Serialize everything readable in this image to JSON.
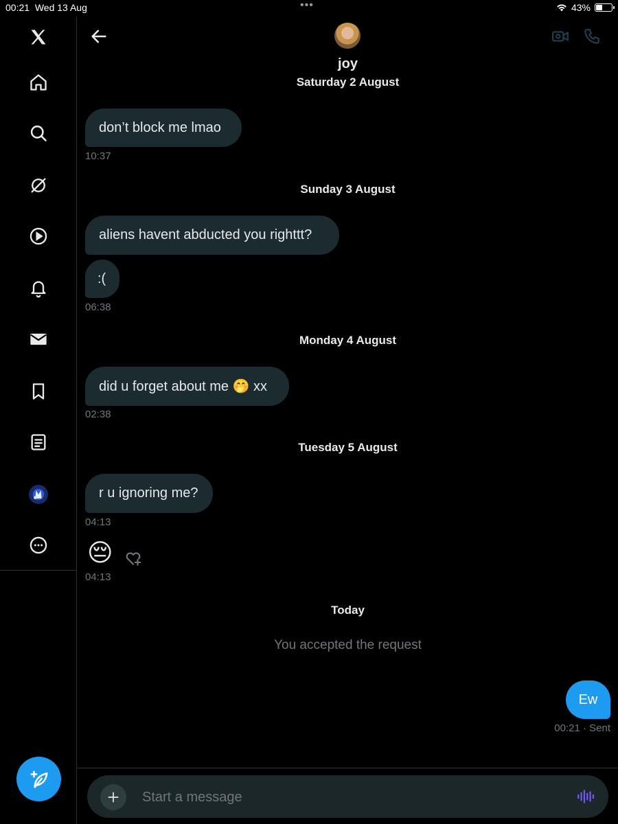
{
  "status_bar": {
    "time": "00:21",
    "date": "Wed 13 Aug",
    "dots": "•••",
    "battery": "43%",
    "battery_level": 0.43
  },
  "sidebar": {
    "items": [
      {
        "name": "x-logo-icon"
      },
      {
        "name": "home-icon"
      },
      {
        "name": "search-icon"
      },
      {
        "name": "grok-icon"
      },
      {
        "name": "video-play-icon"
      },
      {
        "name": "notifications-bell-icon"
      },
      {
        "name": "messages-envelope-icon"
      },
      {
        "name": "bookmark-icon"
      },
      {
        "name": "lists-icon"
      },
      {
        "name": "profile-avatar"
      },
      {
        "name": "more-icon"
      }
    ],
    "compose": {
      "name": "compose-feather-icon"
    }
  },
  "header": {
    "contact_name": "joy",
    "icons": [
      "back-arrow-icon",
      "video-call-icon",
      "phone-call-icon"
    ]
  },
  "conversation": {
    "groups": [
      {
        "date": "Saturday 2 August",
        "messages": [
          {
            "text": "don’t block me lmao"
          }
        ],
        "time": "10:37"
      },
      {
        "date": "Sunday 3 August",
        "messages": [
          {
            "text": "aliens havent abducted you righttt?"
          },
          {
            "text": ":("
          }
        ],
        "time": "06:38"
      },
      {
        "date": "Monday 4 August",
        "messages": [
          {
            "text": "did u forget about me 🤭 xx"
          }
        ],
        "time": "02:38"
      },
      {
        "date": "Tuesday 5 August",
        "messages": [
          {
            "text": "r u ignoring me?"
          }
        ],
        "time": "04:13",
        "emoji_message": {
          "text": "😔",
          "time": "04:13",
          "reaction_icon": "add-reaction-heart-icon"
        }
      }
    ],
    "today": {
      "date": "Today",
      "system_message": "You accepted the request",
      "sent_message": {
        "text": "Ew",
        "time": "00:21",
        "status": "· Sent"
      }
    }
  },
  "composer": {
    "placeholder": "Start a message",
    "icons": [
      "plus-icon",
      "voice-waveform-icon"
    ]
  },
  "colors": {
    "accent": "#1d9bf0",
    "received_bubble": "#1b2b2f",
    "muted_text": "#71767b",
    "voice_icon": "#7856ff"
  }
}
